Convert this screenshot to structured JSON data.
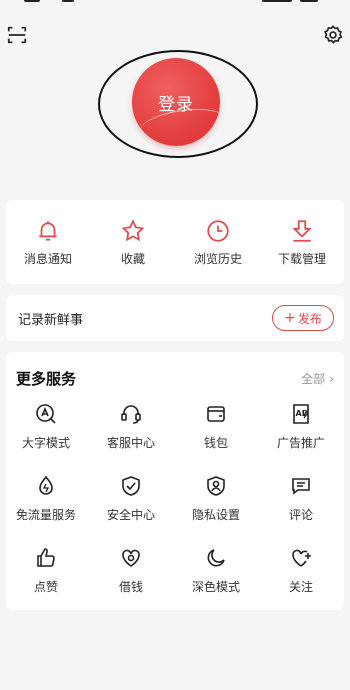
{
  "header": {
    "scan_icon": "scan-icon",
    "settings_icon": "gear-icon",
    "login_label": "登录"
  },
  "quick_actions": [
    {
      "label": "消息通知",
      "icon": "bell-icon"
    },
    {
      "label": "收藏",
      "icon": "star-icon"
    },
    {
      "label": "浏览历史",
      "icon": "clock-icon"
    },
    {
      "label": "下载管理",
      "icon": "download-icon"
    }
  ],
  "post": {
    "title": "记录新鲜事",
    "button_label": "发布",
    "button_plus": "+"
  },
  "services": {
    "title": "更多服务",
    "all_label": "全部",
    "all_chevron": "›",
    "items": [
      {
        "label": "大字模式",
        "icon": "font-size-icon"
      },
      {
        "label": "客服中心",
        "icon": "headset-icon"
      },
      {
        "label": "钱包",
        "icon": "wallet-icon"
      },
      {
        "label": "广告推广",
        "icon": "ad-icon"
      },
      {
        "label": "免流量服务",
        "icon": "droplet-icon"
      },
      {
        "label": "安全中心",
        "icon": "shield-check-icon"
      },
      {
        "label": "隐私设置",
        "icon": "privacy-icon"
      },
      {
        "label": "评论",
        "icon": "comment-icon"
      },
      {
        "label": "点赞",
        "icon": "thumbs-up-icon"
      },
      {
        "label": "借钱",
        "icon": "loan-icon"
      },
      {
        "label": "深色模式",
        "icon": "moon-icon"
      },
      {
        "label": "关注",
        "icon": "heart-plus-icon"
      }
    ]
  },
  "colors": {
    "accent": "#e23b3b",
    "background": "#f5f5f5",
    "card": "#ffffff"
  }
}
